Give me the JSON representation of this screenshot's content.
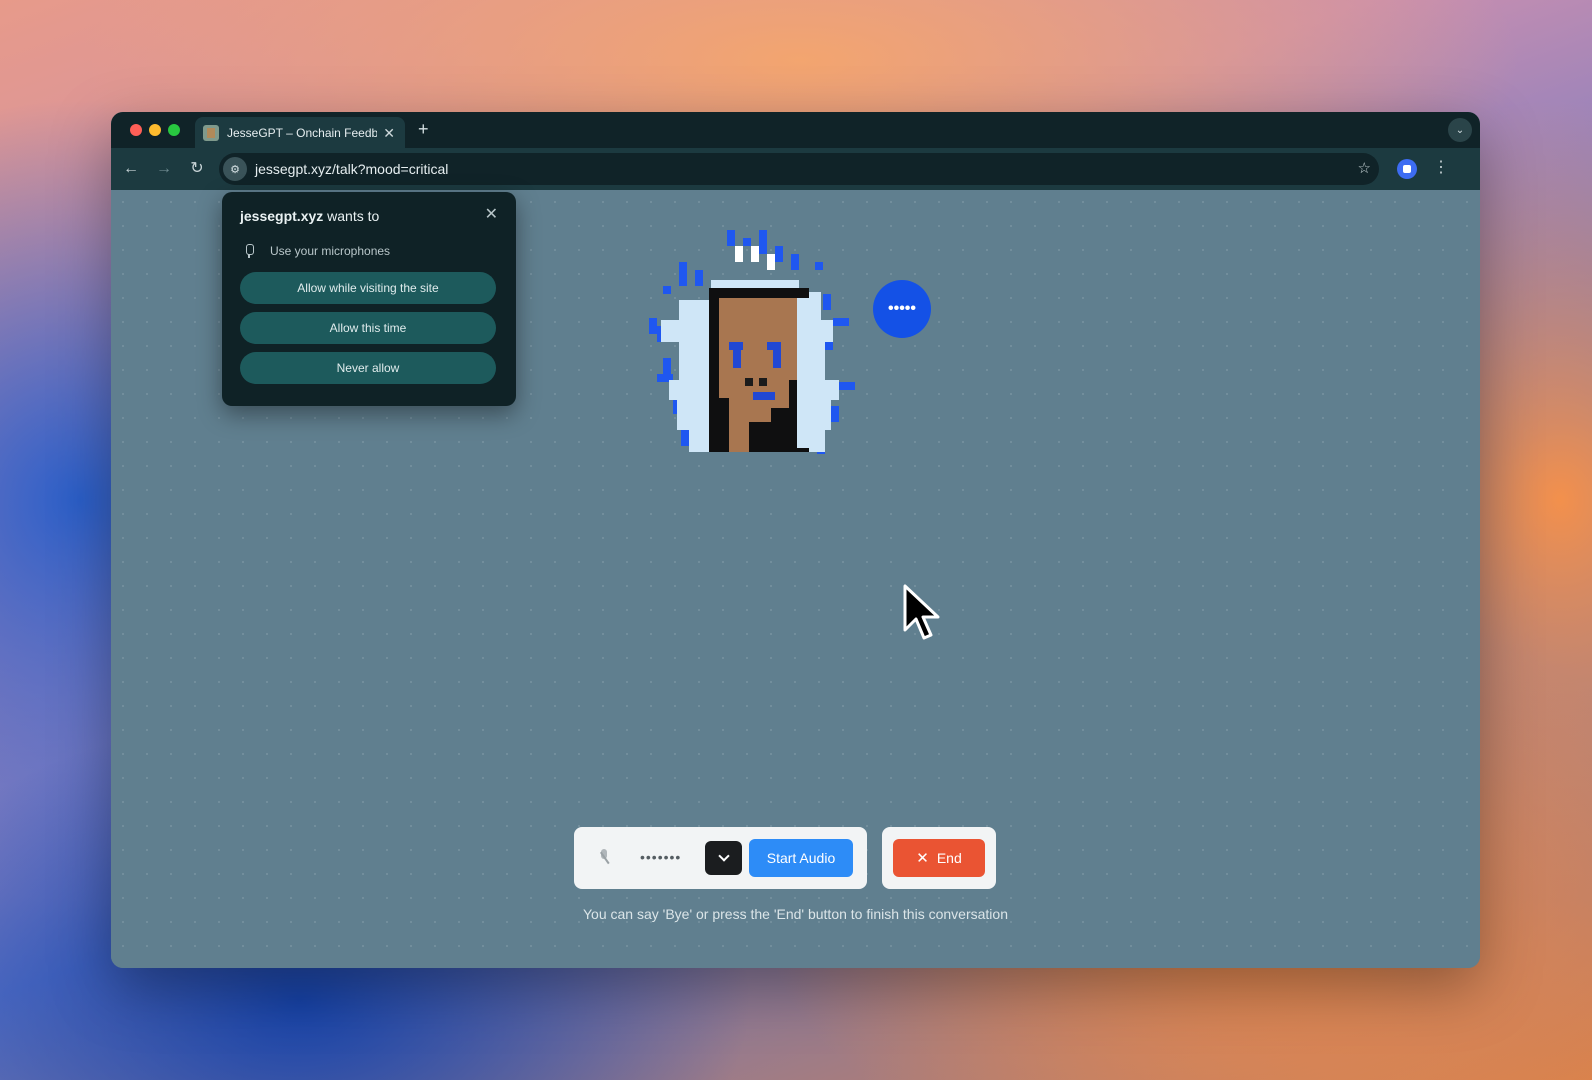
{
  "browser": {
    "tab": {
      "title": "JesseGPT – Onchain Feedback",
      "close": "✕"
    },
    "new_tab": "+",
    "url": "jessegpt.xyz/talk?mood=critical",
    "nav": {
      "back": "←",
      "forward": "→",
      "reload": "↻"
    },
    "star": "☆",
    "menu": "⋮"
  },
  "permission_prompt": {
    "site": "jessegpt.xyz",
    "wants_to": " wants to",
    "permission": "Use your microphones",
    "close": "✕",
    "buttons": {
      "allow_always": "Allow while visiting the site",
      "allow_once": "Allow this time",
      "never": "Never allow"
    }
  },
  "speech_bubble": "•••••",
  "controls": {
    "mic_level": "•••••••",
    "start_audio": "Start Audio",
    "end": "End",
    "end_icon": "✕"
  },
  "hint": "You can say 'Bye' or press the 'End' button to finish this conversation",
  "colors": {
    "page_bg": "#607f8f",
    "start_audio": "#2d8cf7",
    "end_button": "#ea5433",
    "bubble": "#1451e6"
  }
}
